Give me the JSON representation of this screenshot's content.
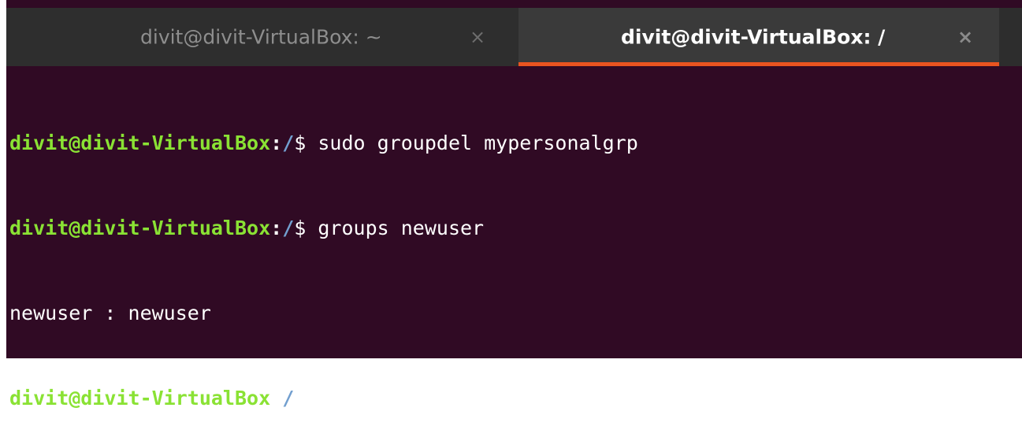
{
  "tabs": [
    {
      "label": "divit@divit-VirtualBox: ~",
      "close": "×",
      "active": false
    },
    {
      "label": "divit@divit-VirtualBox: /",
      "close": "×",
      "active": true
    }
  ],
  "colors": {
    "background": "#300a24",
    "prompt_user": "#8ae234",
    "prompt_path": "#729fcf",
    "tab_accent": "#e95420"
  },
  "terminal": {
    "lines": [
      {
        "user": "divit@divit-VirtualBox",
        "sep": ":",
        "path": "/",
        "dollar": "$ ",
        "cmd": "sudo groupdel mypersonalgrp"
      },
      {
        "user": "divit@divit-VirtualBox",
        "sep": ":",
        "path": "/",
        "dollar": "$ ",
        "cmd": "groups newuser"
      },
      {
        "output": "newuser : newuser"
      },
      {
        "user": "divit@divit-VirtualBox",
        "sep": ":",
        "path": "/",
        "dollar": "$ ",
        "cmd": ""
      }
    ]
  }
}
